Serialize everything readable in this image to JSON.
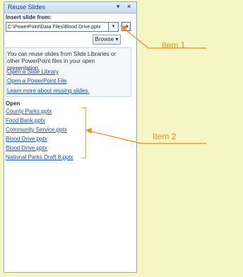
{
  "pane": {
    "title": "Reuse Slides",
    "dropdown_glyph": "▾",
    "close_glyph": "×",
    "insert_label": "Insert slide from:",
    "path_value": "C:\\PowerPoint\\Data Files\\Blood Drive.pptx",
    "path_dropdown_glyph": "▾",
    "go_glyph": "➔",
    "browse_label": "Browse ▾",
    "info_text": "You can reuse slides from Slide Libraries or other PowerPoint files in your open presentation.",
    "links": [
      "Open a Slide Library",
      "Open a PowerPoint File",
      "Learn more about reusing slides."
    ],
    "open_label": "Open",
    "files": [
      "County Parks.pptx",
      "Food Bank.pptx",
      "Community Service.pptx",
      "Blood Drive.pptx",
      "Blood Drive.pptx",
      "National Parks Draft 8.pptx"
    ]
  },
  "callouts": {
    "item1": "Item 1",
    "item2": "Item 2"
  },
  "colors": {
    "background": "#f6f6c4",
    "callout": "#f08a1c",
    "link": "#1a4fb0"
  }
}
